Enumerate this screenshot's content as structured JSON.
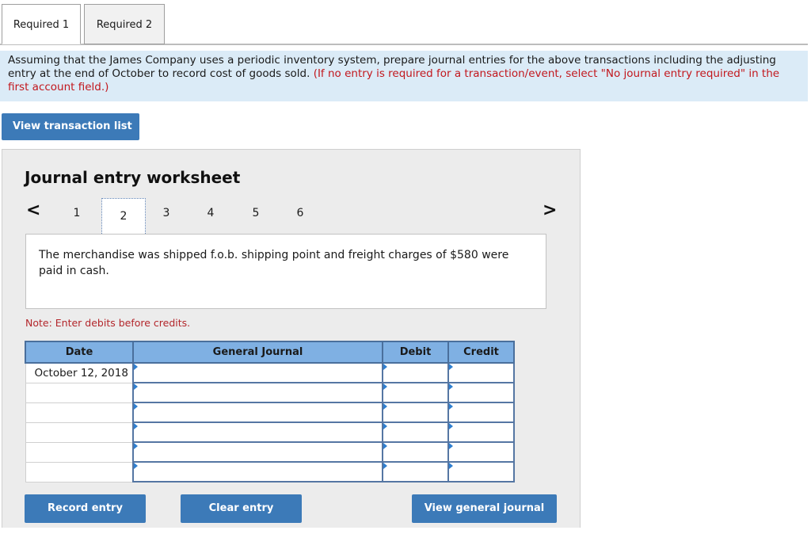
{
  "tabs": [
    {
      "label": "Required 1",
      "active": true
    },
    {
      "label": "Required 2",
      "active": false
    }
  ],
  "instruction": {
    "main": "Assuming that the James Company uses a periodic inventory system, prepare journal entries for the above transactions including the adjusting entry at the end of October to record cost of goods sold.",
    "hint": "(If no entry is required for a transaction/event, select \"No journal entry required\" in the first account field.)"
  },
  "buttons": {
    "view_transaction_list": "View transaction list",
    "record_entry": "Record entry",
    "clear_entry": "Clear entry",
    "view_general_journal": "View general journal"
  },
  "worksheet": {
    "title": "Journal entry worksheet",
    "nav_prev_icon": "chevron-left-icon",
    "nav_next_icon": "chevron-right-icon",
    "pages": [
      "1",
      "2",
      "3",
      "4",
      "5",
      "6"
    ],
    "current_page": "2",
    "description": "The merchandise was shipped f.o.b. shipping point and freight charges of $580 were paid in cash.",
    "note": "Note: Enter debits before credits."
  },
  "journal": {
    "headers": {
      "date": "Date",
      "general_journal": "General Journal",
      "debit": "Debit",
      "credit": "Credit"
    },
    "rows": [
      {
        "date": "October 12, 2018",
        "account": "",
        "debit": "",
        "credit": ""
      },
      {
        "date": "",
        "account": "",
        "debit": "",
        "credit": ""
      },
      {
        "date": "",
        "account": "",
        "debit": "",
        "credit": ""
      },
      {
        "date": "",
        "account": "",
        "debit": "",
        "credit": ""
      },
      {
        "date": "",
        "account": "",
        "debit": "",
        "credit": ""
      },
      {
        "date": "",
        "account": "",
        "debit": "",
        "credit": ""
      }
    ]
  },
  "colors": {
    "accent": "#3c7ab8",
    "header_blue": "#7fb0e3",
    "instruction_bg": "#dbebf7",
    "note_red": "#b3262b"
  }
}
